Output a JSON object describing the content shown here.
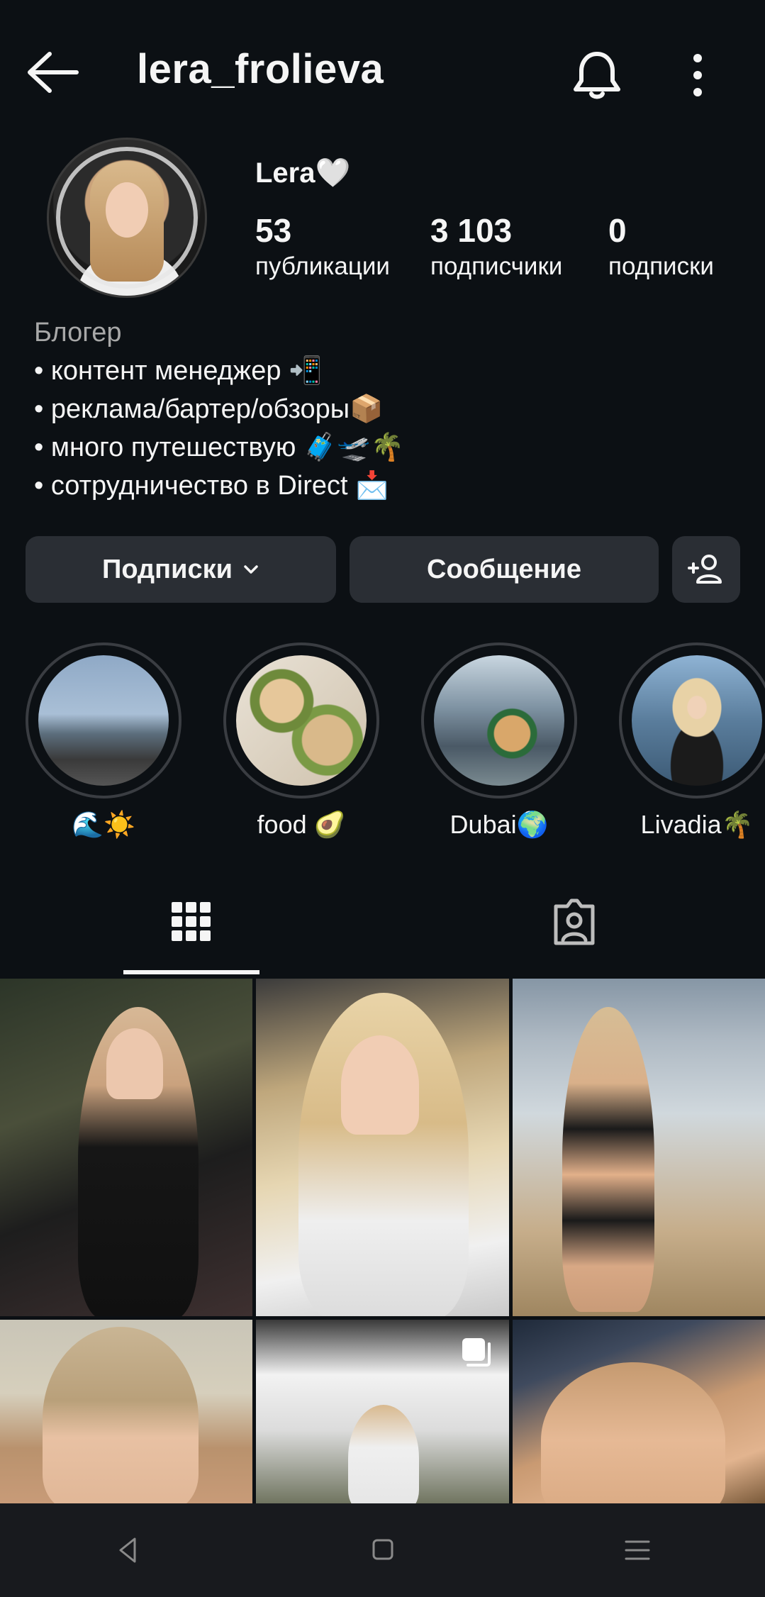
{
  "header": {
    "username": "lera_frolieva",
    "back_icon": "arrow-left-icon",
    "bell_icon": "bell-icon",
    "more_icon": "more-vertical-icon"
  },
  "profile": {
    "display_name": "Lera🤍",
    "stats": [
      {
        "value": "53",
        "label": "публикации"
      },
      {
        "value": "3 103",
        "label": "подписчики"
      },
      {
        "value": "0",
        "label": "подписки"
      }
    ]
  },
  "bio": {
    "category": "Блогер",
    "lines": [
      "• контент менеджер 📲",
      "• реклама/бартер/обзоры📦",
      "• много путешествую 🧳🛫🌴",
      "• сотрудничество в Direct 📩"
    ]
  },
  "actions": {
    "following_label": "Подписки",
    "message_label": "Сообщение",
    "add_user_icon": "person-add-icon"
  },
  "highlights": [
    {
      "label": "🌊☀️"
    },
    {
      "label": "food 🥑"
    },
    {
      "label": "Dubai🌍"
    },
    {
      "label": "Livadia🌴"
    }
  ],
  "tabs": {
    "grid_icon": "grid-icon",
    "tagged_icon": "tagged-person-icon",
    "active": "grid"
  },
  "colors": {
    "background": "#0c1014",
    "button": "#2a2e34",
    "text": "#f5f5f5",
    "muted": "#a8a8a8"
  }
}
